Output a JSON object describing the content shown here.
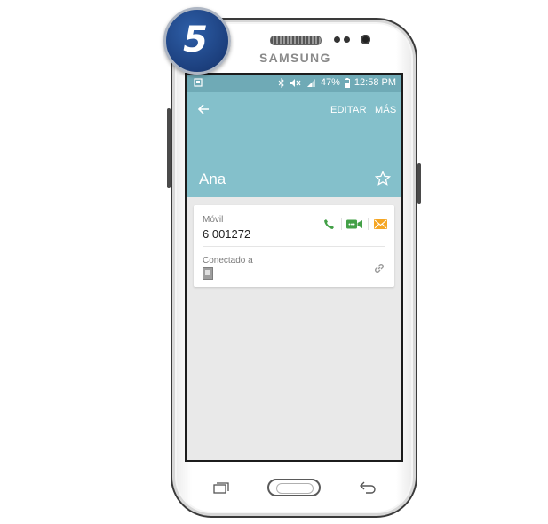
{
  "step_badge": {
    "number": "5"
  },
  "device": {
    "brand": "SAMSUNG"
  },
  "status_bar": {
    "battery": "47%",
    "time": "12:58 PM",
    "icons": [
      "screenshot-icon",
      "bluetooth-icon",
      "mute-icon",
      "signal-icon",
      "battery-icon"
    ]
  },
  "header": {
    "edit_label": "EDITAR",
    "more_label": "MÁS",
    "contact_name": "Ana",
    "background": "#84c0cb"
  },
  "phone_entry": {
    "label": "Móvil",
    "number": "6 001272"
  },
  "connected_entry": {
    "label": "Conectado a"
  },
  "colors": {
    "call": "#43a047",
    "video": "#43a047",
    "message": "#f5a623",
    "status_bar": "#6faab6",
    "content_bg": "#e9e9e9"
  }
}
